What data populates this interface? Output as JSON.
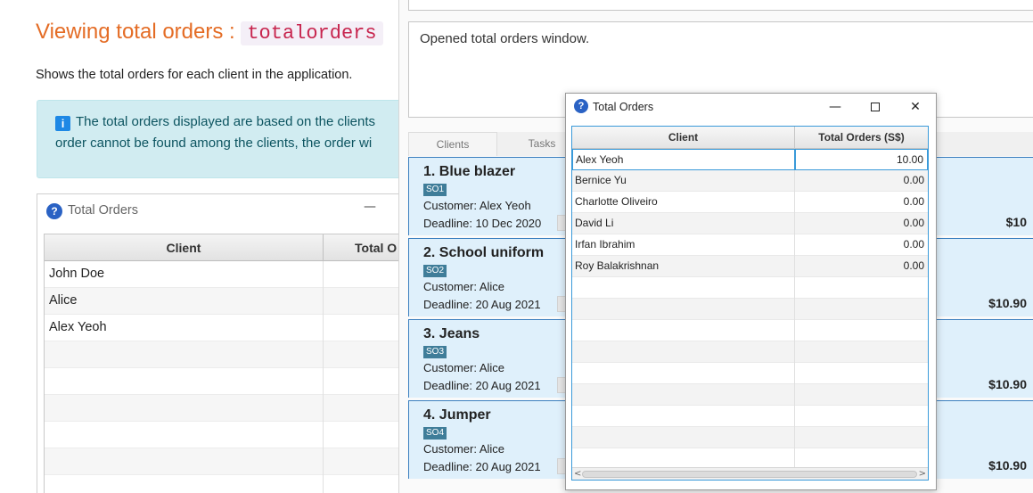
{
  "doc": {
    "title_prefix": "Viewing total orders : ",
    "title_command": "totalorders",
    "description": "Shows the total orders for each client in the application.",
    "info_line1": "The total orders displayed are based on the clients",
    "info_line2": "order cannot be found among the clients, the order wi",
    "info_icon": "i",
    "embed_window": {
      "title": "Total Orders",
      "minimize": "—",
      "columns": [
        "Client",
        "Total O"
      ],
      "rows": [
        "John Doe",
        "Alice",
        "Alex Yeoh"
      ]
    }
  },
  "app": {
    "result_text": "Opened total orders window.",
    "tabs": [
      "Clients",
      "Tasks"
    ],
    "orders": [
      {
        "title": "1. Blue blazer",
        "tag": "SO1",
        "customer": "Customer:  Alex Yeoh",
        "deadline": "Deadline:  10 Dec 2020",
        "price": "$10"
      },
      {
        "title": "2. School uniform",
        "tag": "SO2",
        "customer": "Customer:  Alice",
        "deadline": "Deadline:  20 Aug 2021",
        "price": "$10.90"
      },
      {
        "title": "3. Jeans",
        "tag": "SO3",
        "customer": "Customer:  Alice",
        "deadline": "Deadline:  20 Aug 2021",
        "price": "$10.90"
      },
      {
        "title": "4. Jumper",
        "tag": "SO4",
        "customer": "Customer:  Alice",
        "deadline": "Deadline:  20 Aug 2021",
        "price": "$10.90"
      }
    ]
  },
  "popup": {
    "title": "Total Orders",
    "icon": "?",
    "buttons": {
      "minimize": "—",
      "close": "✕"
    },
    "columns": [
      "Client",
      "Total Orders (S$)"
    ],
    "rows": [
      {
        "client": "Alex Yeoh",
        "total": "10.00"
      },
      {
        "client": "Bernice Yu",
        "total": "0.00"
      },
      {
        "client": "Charlotte Oliveiro",
        "total": "0.00"
      },
      {
        "client": "David Li",
        "total": "0.00"
      },
      {
        "client": "Irfan Ibrahim",
        "total": "0.00"
      },
      {
        "client": "Roy Balakrishnan",
        "total": "0.00"
      }
    ],
    "scroll_left": "<",
    "scroll_right": ">"
  }
}
